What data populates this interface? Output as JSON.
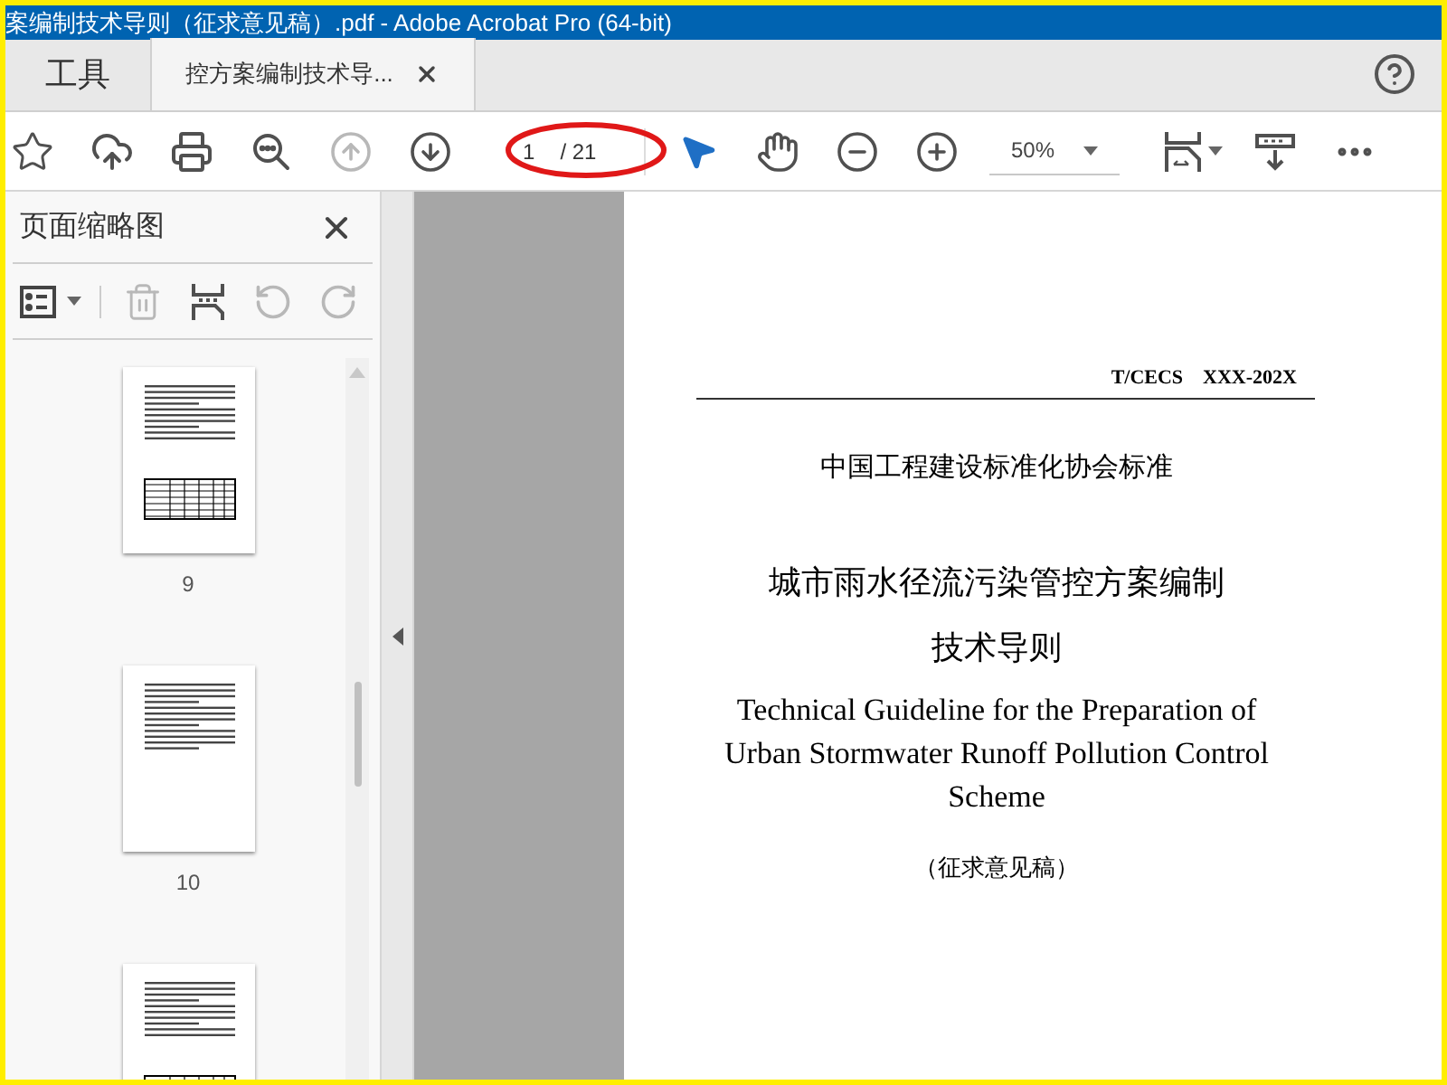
{
  "window": {
    "title": "案编制技术导则（征求意见稿）.pdf - Adobe Acrobat Pro (64-bit)"
  },
  "tabs": [
    {
      "label": "工具",
      "selected": false,
      "closable": false
    },
    {
      "label": "控方案编制技术导...",
      "selected": true,
      "closable": true
    }
  ],
  "toolbar": {
    "page_nav": [
      {
        "kind": "previous",
        "disabled": true
      },
      {
        "kind": "next",
        "disabled": false
      }
    ],
    "page_field": {
      "value": "1",
      "total": "/ 21"
    },
    "zoom": {
      "value": "50%"
    },
    "annotation": {
      "kind": "ellipse"
    }
  },
  "sidebar": {
    "title": "页面缩略图",
    "tools": [
      {
        "kind": "delete",
        "disabled": true
      },
      {
        "kind": "insert",
        "disabled": false
      },
      {
        "kind": "rotate_left",
        "disabled": true
      },
      {
        "kind": "rotate_right",
        "disabled": true
      }
    ],
    "thumbnails": [
      {
        "label": "9",
        "kind": "table"
      },
      {
        "label": "10",
        "kind": "text"
      },
      {
        "kind": "table"
      }
    ]
  },
  "document": {
    "code": "T/CECS　XXX-202X",
    "org": "中国工程建设标准化协会标准",
    "title_lines": [
      "城市雨水径流污染管控方案编制",
      "技术导则"
    ],
    "english_lines": [
      "Technical Guideline for the Preparation of",
      "Urban Stormwater Runoff Pollution Control",
      "Scheme"
    ],
    "status": "（征求意见稿）"
  }
}
